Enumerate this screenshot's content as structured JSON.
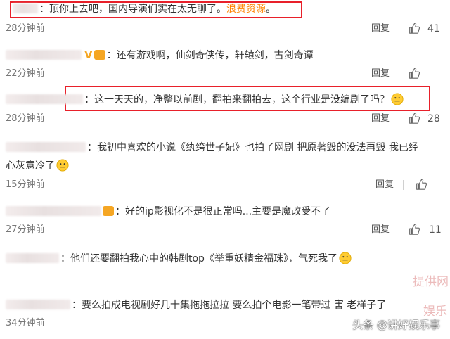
{
  "comments": [
    {
      "text": "：顶你上去吧，国内导演们实在太无聊了。",
      "highlight": "浪费资源",
      "tail": "。",
      "time": "28分钟前",
      "reply": "回复",
      "likes": "41"
    },
    {
      "text": "：还有游戏啊，仙剑奇侠传，轩辕剑，古剑奇谭",
      "badge": "V",
      "time": "22分钟前",
      "reply": "回复",
      "likes": ""
    },
    {
      "text": "：这一天天的，净整以前剧，翻拍来翻拍去，这个行业是没编剧了吗？",
      "time": "28分钟前",
      "reply": "回复",
      "likes": "28"
    },
    {
      "text": "：我初中喜欢的小说《纨绔世子妃》也拍了网剧 把原著毁的没法再毁 我已经",
      "text2": "心灰意冷了",
      "time": "15分钟前",
      "reply": "回复",
      "likes": ""
    },
    {
      "text": "：好的ip影视化不是很正常吗...主要是魔改受不了",
      "time": "27分钟前",
      "reply": "回复",
      "likes": "11"
    },
    {
      "text": "：他们还要翻拍我心中的韩剧top《举重妖精金福珠》，气死我了",
      "time": "",
      "reply": "",
      "likes": ""
    },
    {
      "text": "：要么拍成电视剧好几十集拖拖拉拉 要么拍个电影一笔带过 害 老样子了",
      "time": "34分钟前",
      "reply": "",
      "likes": ""
    }
  ],
  "watermark": "头条 @讲好娱乐事",
  "side_mark_1": "提供网",
  "side_mark_2": "娱乐",
  "colors": {
    "highlight_box": "#e8202a",
    "link_orange": "#ff8200"
  },
  "icons": {
    "thumb": "thumbs-up-icon",
    "emoji": "thinking-face-emoji"
  }
}
